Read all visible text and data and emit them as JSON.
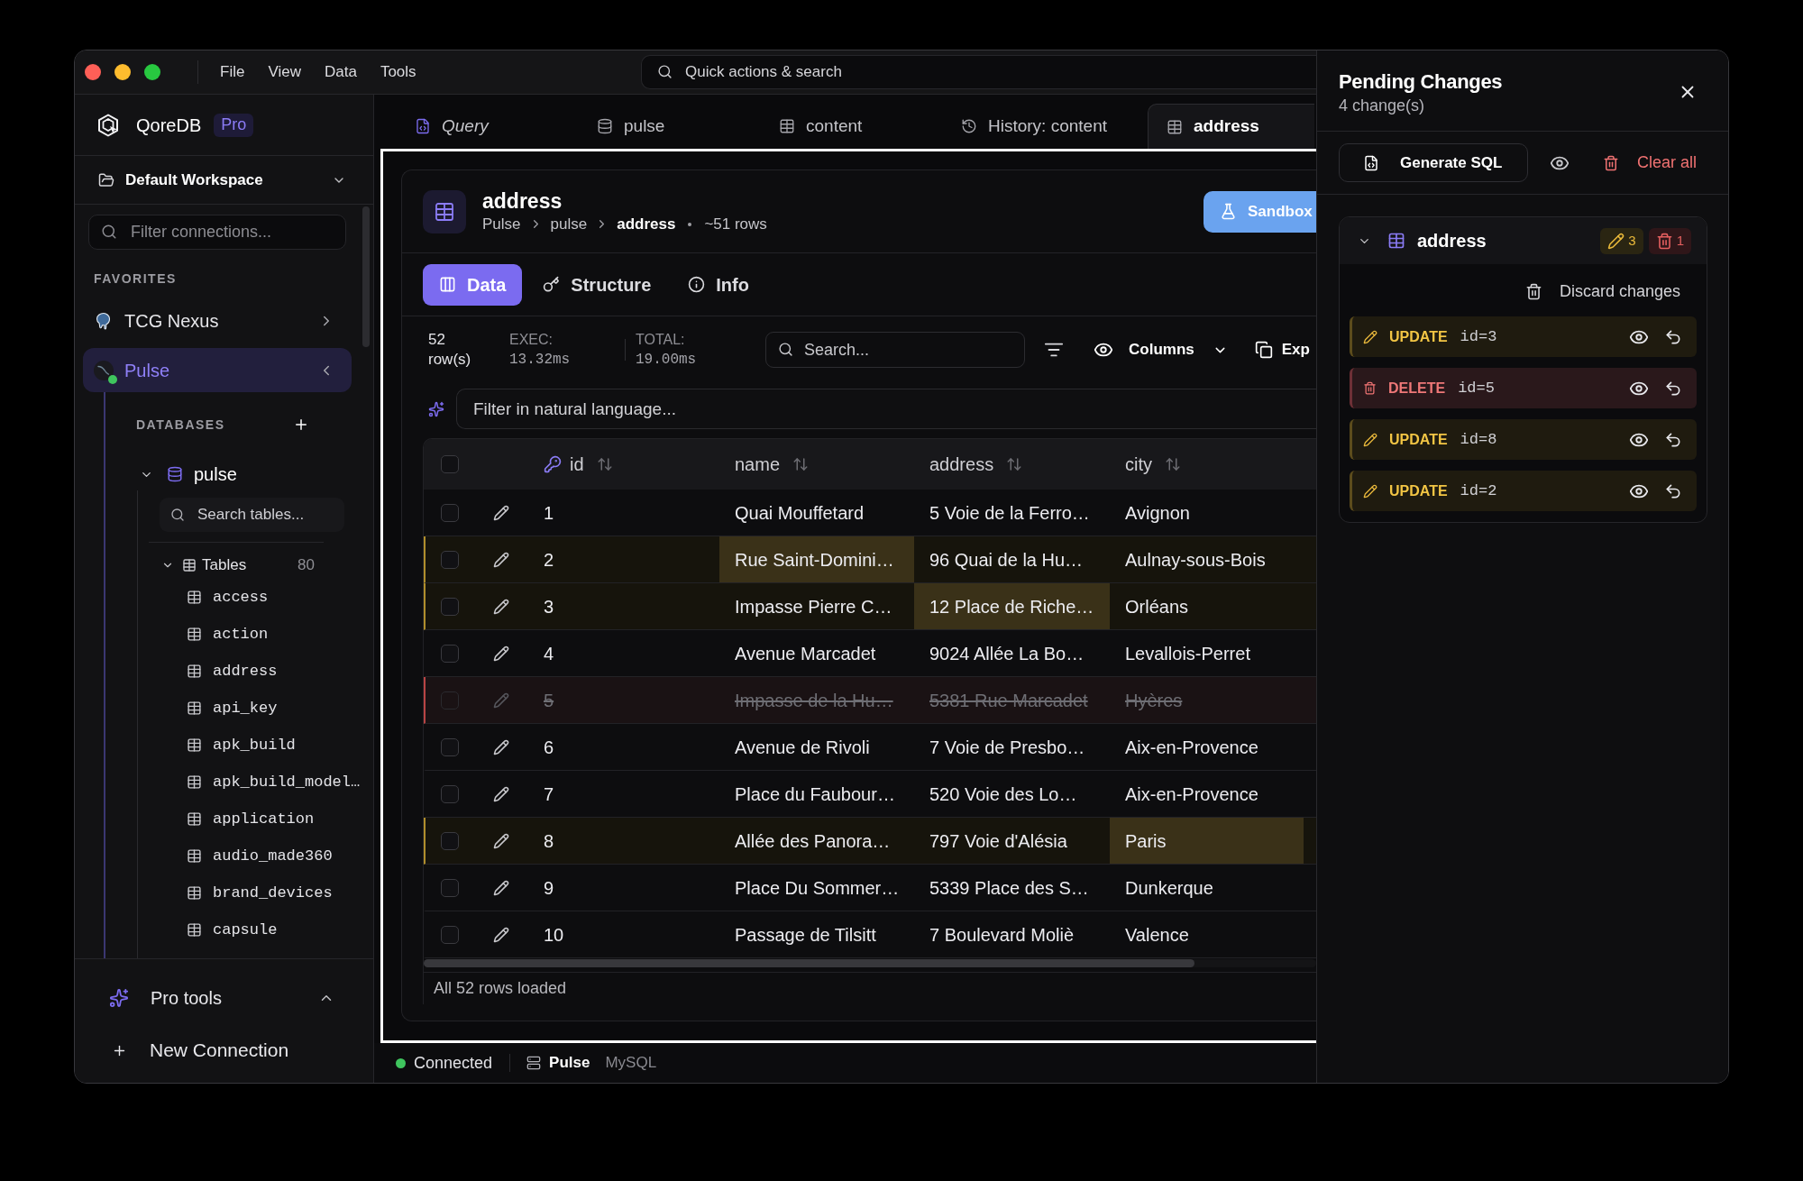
{
  "window": {
    "menu": [
      "File",
      "View",
      "Data",
      "Tools"
    ],
    "search_placeholder": "Quick actions & search"
  },
  "sidebar": {
    "app_name": "QoreDB",
    "plan_badge": "Pro",
    "workspace": "Default Workspace",
    "filter_placeholder": "Filter connections...",
    "favorites_heading": "FAVORITES",
    "connections": [
      {
        "name": "TCG Nexus",
        "kind": "postgres",
        "selected": false,
        "expanded": false,
        "connected": false
      },
      {
        "name": "Pulse",
        "kind": "mysql",
        "selected": true,
        "expanded": true,
        "connected": true,
        "databases_heading": "DATABASES",
        "databases": [
          {
            "name": "pulse",
            "expanded": true,
            "search_placeholder": "Search tables...",
            "groups": [
              {
                "label": "Tables",
                "count": "80",
                "expanded": true,
                "children": [
                  {
                    "name": "access"
                  },
                  {
                    "name": "action"
                  },
                  {
                    "name": "address"
                  },
                  {
                    "name": "api_key"
                  },
                  {
                    "name": "apk_build"
                  },
                  {
                    "name": "apk_build_model…"
                  },
                  {
                    "name": "application"
                  },
                  {
                    "name": "audio_made360"
                  },
                  {
                    "name": "brand_devices"
                  },
                  {
                    "name": "capsule"
                  }
                ]
              }
            ]
          }
        ]
      }
    ],
    "pro_tools": "Pro tools",
    "new_connection": "New Connection"
  },
  "tabs": [
    {
      "label": "Query",
      "kind": "query",
      "selected": false
    },
    {
      "label": "pulse",
      "kind": "database",
      "selected": false
    },
    {
      "label": "content",
      "kind": "table",
      "selected": false
    },
    {
      "label": "History: content",
      "kind": "history",
      "selected": false
    },
    {
      "label": "address",
      "kind": "table",
      "selected": true
    }
  ],
  "table_view": {
    "title": "address",
    "breadcrumb": [
      "Pulse",
      "pulse",
      "address"
    ],
    "row_estimate": "~51 rows",
    "sandbox_button": "Sandbox",
    "view_tabs": [
      {
        "label": "Data",
        "kind": "data",
        "selected": true
      },
      {
        "label": "Structure",
        "kind": "structure",
        "selected": false
      },
      {
        "label": "Info",
        "kind": "info",
        "selected": false
      }
    ],
    "stats": {
      "rows": "52",
      "rows_label": "row(s)",
      "exec_label": "EXEC:",
      "exec": "13.32ms",
      "total_label": "TOTAL:",
      "total": "19.00ms"
    },
    "search_placeholder": "Search...",
    "columns_button": "Columns",
    "export_button": "Exp",
    "nl_filter_placeholder": "Filter in natural language...",
    "select_all_checked": false,
    "columns": [
      {
        "label": "id",
        "primary_key": true
      },
      {
        "label": "name",
        "primary_key": false
      },
      {
        "label": "address",
        "primary_key": false
      },
      {
        "label": "city",
        "primary_key": false
      }
    ],
    "rows": [
      {
        "kind": "normal",
        "checked": false,
        "cells": [
          {
            "text": "1",
            "changed": false
          },
          {
            "text": "Quai Mouffetard",
            "changed": false
          },
          {
            "text": "5 Voie de la Ferro…",
            "changed": false
          },
          {
            "text": "Avignon",
            "changed": false
          }
        ]
      },
      {
        "kind": "updated",
        "checked": false,
        "cells": [
          {
            "text": "2",
            "changed": false
          },
          {
            "text": "Rue Saint-Domini…",
            "changed": true
          },
          {
            "text": "96 Quai de la Hu…",
            "changed": false
          },
          {
            "text": "Aulnay-sous-Bois",
            "changed": false
          }
        ]
      },
      {
        "kind": "updated",
        "checked": false,
        "cells": [
          {
            "text": "3",
            "changed": false
          },
          {
            "text": "Impasse Pierre C…",
            "changed": false
          },
          {
            "text": "12 Place de Riche…",
            "changed": true
          },
          {
            "text": "Orléans",
            "changed": false
          }
        ]
      },
      {
        "kind": "normal",
        "checked": false,
        "cells": [
          {
            "text": "4",
            "changed": false
          },
          {
            "text": "Avenue Marcadet",
            "changed": false
          },
          {
            "text": "9024 Allée La Bo…",
            "changed": false
          },
          {
            "text": "Levallois-Perret",
            "changed": false
          }
        ]
      },
      {
        "kind": "deleted",
        "checked": false,
        "cells": [
          {
            "text": "5",
            "changed": false
          },
          {
            "text": "Impasse de la Hu…",
            "changed": false
          },
          {
            "text": "5381 Rue Marcadet",
            "changed": false
          },
          {
            "text": "Hyères",
            "changed": false
          }
        ]
      },
      {
        "kind": "normal",
        "checked": false,
        "cells": [
          {
            "text": "6",
            "changed": false
          },
          {
            "text": "Avenue de Rivoli",
            "changed": false
          },
          {
            "text": "7 Voie de Presbo…",
            "changed": false
          },
          {
            "text": "Aix-en-Provence",
            "changed": false
          }
        ]
      },
      {
        "kind": "normal",
        "checked": false,
        "cells": [
          {
            "text": "7",
            "changed": false
          },
          {
            "text": "Place du Faubour…",
            "changed": false
          },
          {
            "text": "520 Voie des Lo…",
            "changed": false
          },
          {
            "text": "Aix-en-Provence",
            "changed": false
          }
        ]
      },
      {
        "kind": "updated",
        "checked": false,
        "cells": [
          {
            "text": "8",
            "changed": false
          },
          {
            "text": "Allée des Panora…",
            "changed": false
          },
          {
            "text": "797 Voie d'Alésia",
            "changed": false
          },
          {
            "text": "Paris",
            "changed": true
          }
        ]
      },
      {
        "kind": "normal",
        "checked": false,
        "cells": [
          {
            "text": "9",
            "changed": false
          },
          {
            "text": "Place Du Sommer…",
            "changed": false
          },
          {
            "text": "5339 Place des S…",
            "changed": false
          },
          {
            "text": "Dunkerque",
            "changed": false
          }
        ]
      },
      {
        "kind": "normal",
        "checked": false,
        "cells": [
          {
            "text": "10",
            "changed": false
          },
          {
            "text": "Passage de Tilsitt",
            "changed": false
          },
          {
            "text": "7 Boulevard Moliè",
            "changed": false
          },
          {
            "text": "Valence",
            "changed": false
          }
        ]
      }
    ],
    "footer": "All 52 rows loaded"
  },
  "status_bar": {
    "status": "Connected",
    "connected": true,
    "connection": "Pulse",
    "engine": "MySQL"
  },
  "pending_changes": {
    "title": "Pending Changes",
    "count": "4 change(s)",
    "generate_button": "Generate SQL",
    "clear_button": "Clear all",
    "groups": [
      {
        "table": "address",
        "expanded": true,
        "update_count": "3",
        "delete_count": "1",
        "discard_button": "Discard changes",
        "changes": [
          {
            "kind": "update",
            "label": "UPDATE",
            "target": "id=3"
          },
          {
            "kind": "delete",
            "label": "DELETE",
            "target": "id=5"
          },
          {
            "kind": "update",
            "label": "UPDATE",
            "target": "id=8"
          },
          {
            "kind": "update",
            "label": "UPDATE",
            "target": "id=2"
          }
        ]
      }
    ]
  }
}
